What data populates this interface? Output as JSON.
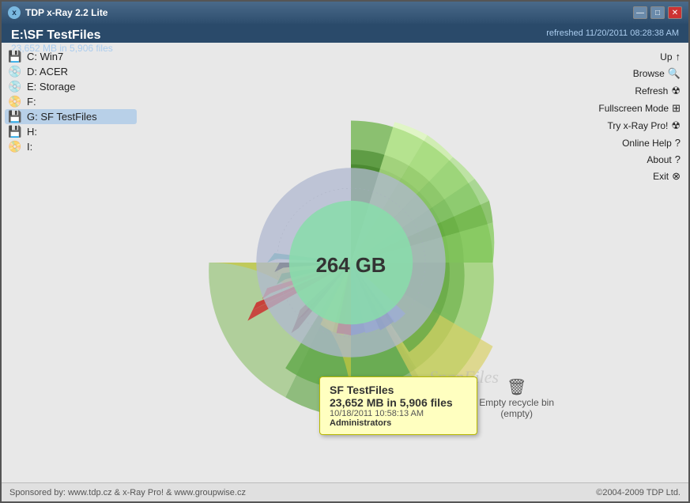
{
  "window": {
    "title": "TDP x-Ray 2.2 Lite",
    "controls": {
      "minimize": "—",
      "maximize": "□",
      "close": "✕"
    }
  },
  "header": {
    "path": "E:\\SF TestFiles",
    "info": "23,652 MB in 5,906 files",
    "refresh_time": "refreshed 11/20/2011 08:28:38 AM"
  },
  "sidebar": {
    "items": [
      {
        "label": "C: Win7",
        "icon": "💾"
      },
      {
        "label": "D: ACER",
        "icon": "💿"
      },
      {
        "label": "E: Storage",
        "icon": "💿"
      },
      {
        "label": "F:",
        "icon": "📀"
      },
      {
        "label": "G: SF TestFiles",
        "icon": "💾"
      },
      {
        "label": "H:",
        "icon": "💾"
      },
      {
        "label": "I:",
        "icon": "📀"
      }
    ]
  },
  "right_panel": {
    "items": [
      {
        "label": "Up",
        "icon": "↑"
      },
      {
        "label": "Browse",
        "icon": "🔍"
      },
      {
        "label": "Refresh",
        "icon": "☢"
      },
      {
        "label": "Fullscreen Mode",
        "icon": "⊠"
      },
      {
        "label": "Try x-Ray Pro!",
        "icon": "☢"
      },
      {
        "label": "Online Help",
        "icon": "?"
      },
      {
        "label": "About",
        "icon": "?"
      },
      {
        "label": "Exit",
        "icon": "⊗"
      }
    ]
  },
  "visualization": {
    "center_label": "264 GB"
  },
  "tooltip": {
    "title": "SF TestFiles",
    "size": "23,652 MB in 5,906 files",
    "date": "10/18/2011 10:58:13 AM",
    "user": "Administrators"
  },
  "recycle_bin": {
    "icon": "🗑",
    "label": "Empty recycle bin",
    "status": "(empty)"
  },
  "watermark": "SnapFiles",
  "footer": {
    "left": "Sponsored by: www.tdp.cz & x-Ray Pro! & www.groupwise.cz",
    "right": "©2004-2009 TDP Ltd."
  }
}
